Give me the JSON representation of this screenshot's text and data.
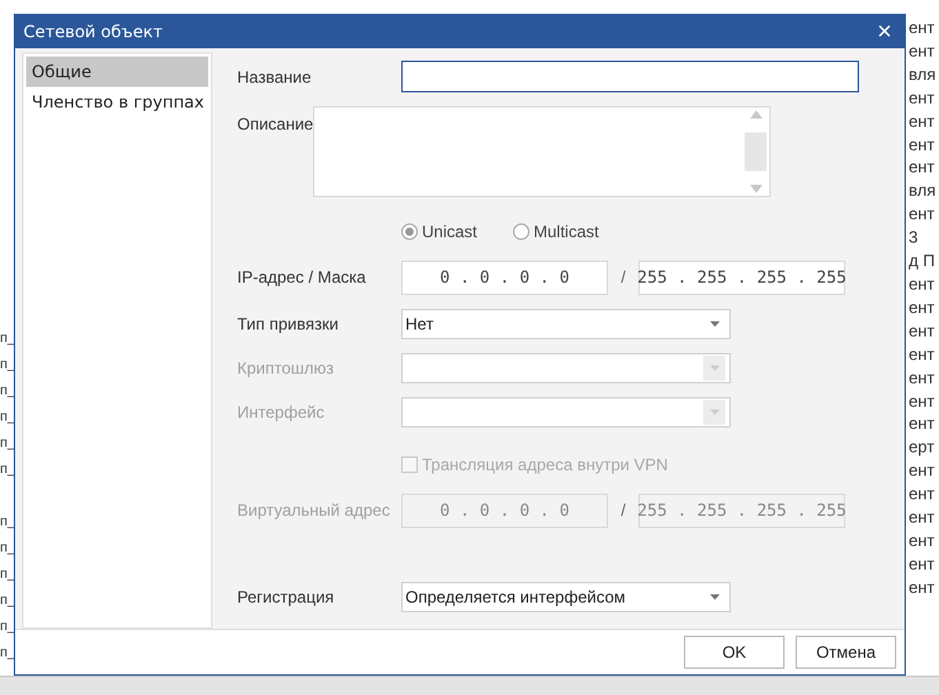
{
  "background": {
    "right_column": [
      "ент",
      "ент",
      "вля",
      "ент",
      "ент",
      "ент",
      "ент",
      "вля",
      "ент",
      "3",
      "д П",
      "ент",
      "ент",
      "ент",
      "ент",
      "ент",
      "ент",
      "ент",
      "ерт",
      "ент",
      "ент",
      "ент",
      "ент",
      "ент",
      "ент"
    ],
    "left_column": [
      "п_",
      "п_",
      "п_",
      "п_",
      "п_",
      "п_",
      "п_",
      "п_",
      "п_",
      "п_",
      "п_",
      "п_"
    ]
  },
  "dialog": {
    "title": "Сетевой объект",
    "sidebar": [
      {
        "label": "Общие",
        "selected": true
      },
      {
        "label": "Членство в группах",
        "selected": false
      }
    ],
    "fields": [
      {
        "kind": "text",
        "label": "Название",
        "focused": true,
        "disabled": false
      },
      {
        "kind": "textarea",
        "label": "Описание",
        "disabled": false
      },
      {
        "kind": "radio",
        "options": [
          {
            "label": "Unicast",
            "selected": true
          },
          {
            "label": "Multicast",
            "selected": false
          }
        ],
        "disabled": false
      },
      {
        "kind": "ip",
        "label": "IP-адрес / Маска",
        "address": "0 . 0 . 0 . 0",
        "separator": "/",
        "mask": "255 . 255 . 255 . 255",
        "disabled": false
      },
      {
        "kind": "select",
        "label": "Тип привязки",
        "value": "Нет",
        "disabled": false
      },
      {
        "kind": "select",
        "label": "Криптошлюз",
        "disabled": true
      },
      {
        "kind": "select",
        "label": "Интерфейс",
        "disabled": true
      },
      {
        "kind": "checkbox",
        "label": "Трансляция адреса внутри VPN",
        "checked": false,
        "disabled": true
      },
      {
        "kind": "ip",
        "label": "Виртуальный адрес",
        "address": "0 . 0 . 0 . 0",
        "separator": "/",
        "mask": "255 . 255 . 255 . 255",
        "disabled": true
      },
      {
        "kind": "select",
        "label": "Регистрация",
        "value": "Определяется интерфейсом",
        "disabled": false
      }
    ],
    "buttons": [
      "OK",
      "Отмена"
    ]
  }
}
